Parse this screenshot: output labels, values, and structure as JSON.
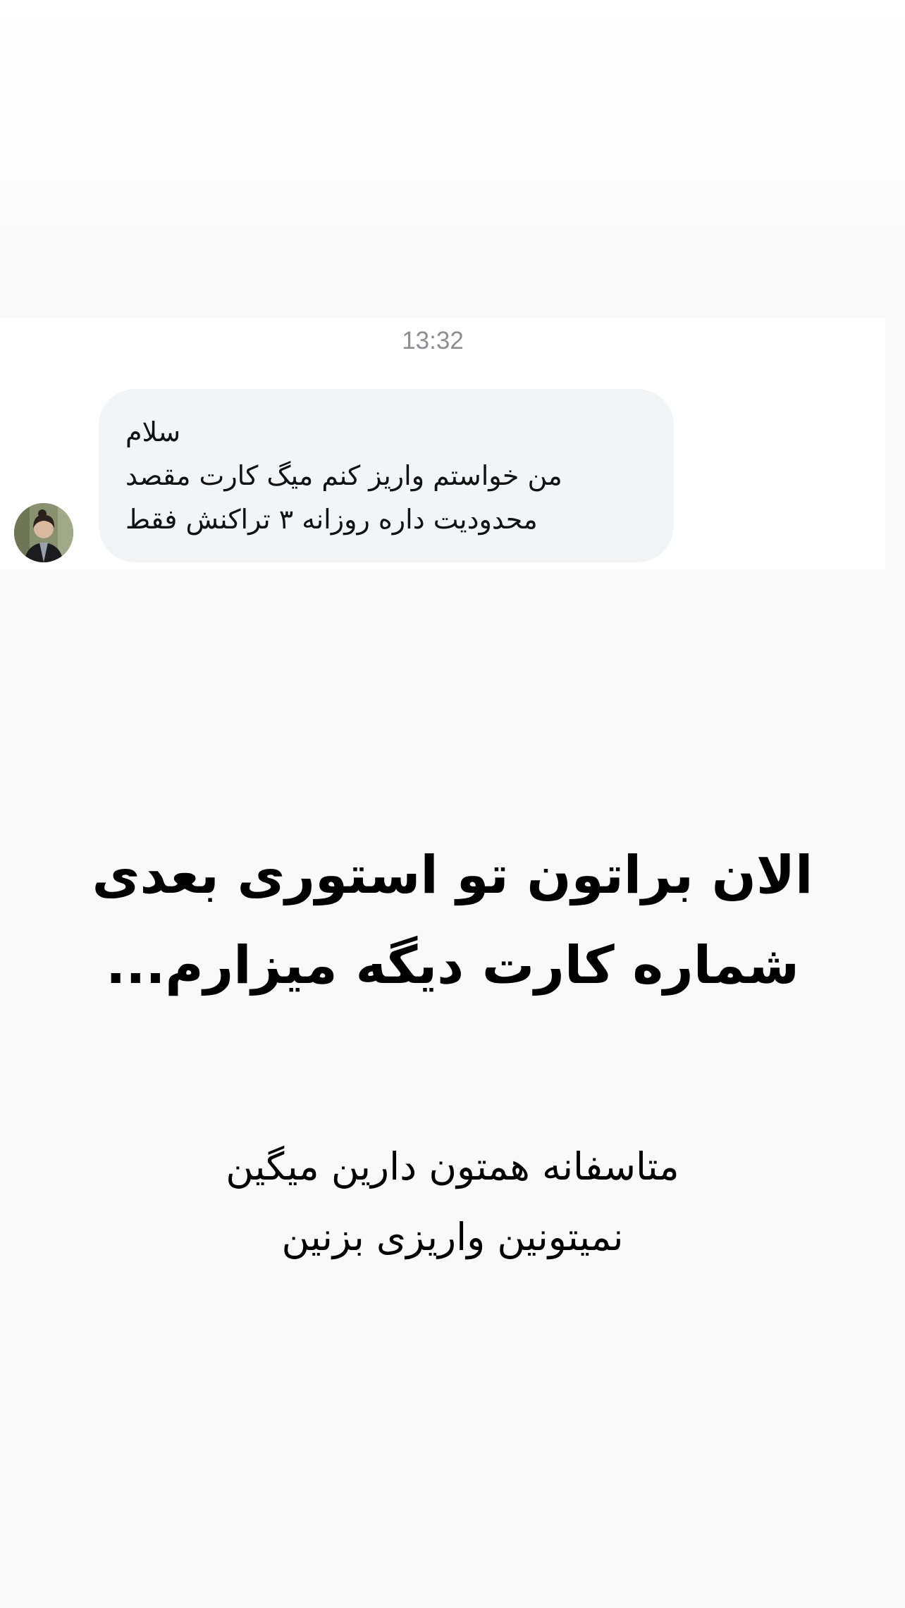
{
  "dm": {
    "timestamp": "13:32",
    "avatar_icon": "profile-photo",
    "message_lines": [
      "سلام",
      "من خواستم واریز کنم میگ کارت مقصد",
      "محدودیت داره روزانه ۳ تراکنش فقط"
    ]
  },
  "story": {
    "headline_lines": [
      "الان براتون تو استوری بعدی",
      "شماره کارت دیگه میزارم..."
    ],
    "subtext_lines": [
      "متاسفانه همتون دارین میگین",
      "نمیتونین واریزی بزنین"
    ]
  },
  "colors": {
    "background": "#f9f9f9",
    "bubble": "#f3f4f6",
    "timestamp": "#8e8e93"
  }
}
